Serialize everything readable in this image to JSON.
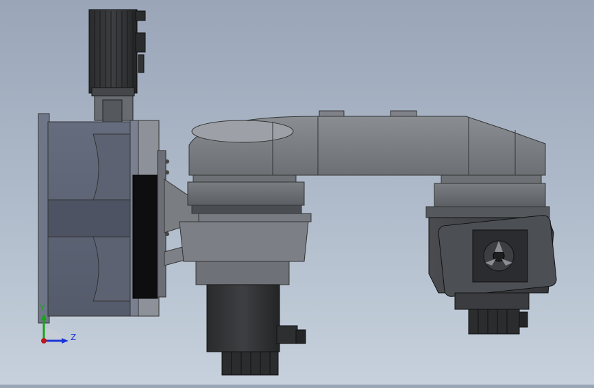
{
  "viewport": {
    "background_top": "#9aa6b8",
    "background_bottom": "#c7d1dd"
  },
  "model": {
    "parts": [
      "servo-motor-top",
      "base-flange",
      "base-housing",
      "first-arm",
      "joint-motor-lower",
      "second-arm",
      "end-effector-chuck",
      "end-motor"
    ]
  },
  "triad": {
    "y_label": "Y",
    "z_label": "Z",
    "colors": {
      "y": "#1aa31a",
      "z": "#1a35d6",
      "origin": "#c01818"
    }
  }
}
